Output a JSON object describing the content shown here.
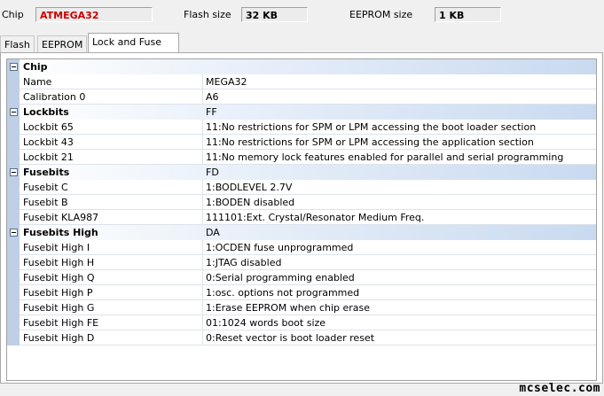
{
  "top": {
    "chip_label": "Chip",
    "chip_value": "ATMEGA32",
    "flash_label": "Flash size",
    "flash_value": "32 KB",
    "eeprom_label": "EEPROM size",
    "eeprom_value": "1 KB"
  },
  "colors": {
    "chip_value": "#cc0000"
  },
  "tabs": [
    {
      "label": "Flash",
      "active": false
    },
    {
      "label": "EEPROM",
      "active": false
    },
    {
      "label": "Lock and Fuse bits",
      "active": true
    }
  ],
  "rows": [
    {
      "type": "cat",
      "name": "Chip",
      "value": ""
    },
    {
      "type": "prop",
      "name": "Name",
      "value": "MEGA32"
    },
    {
      "type": "prop",
      "name": "Calibration 0",
      "value": "A6"
    },
    {
      "type": "cat",
      "name": "Lockbits",
      "value": "FF"
    },
    {
      "type": "prop",
      "name": "Lockbit 65",
      "value": "11:No restrictions for SPM or LPM accessing the boot loader section"
    },
    {
      "type": "prop",
      "name": "Lockbit 43",
      "value": "11:No restrictions for SPM or LPM accessing the application section"
    },
    {
      "type": "prop",
      "name": "Lockbit 21",
      "value": "11:No memory lock features enabled for parallel and serial programming"
    },
    {
      "type": "cat",
      "name": "Fusebits",
      "value": "FD"
    },
    {
      "type": "prop",
      "name": "Fusebit C",
      "value": "1:BODLEVEL 2.7V"
    },
    {
      "type": "prop",
      "name": "Fusebit B",
      "value": "1:BODEN disabled"
    },
    {
      "type": "prop",
      "name": "Fusebit KLA987",
      "value": "111101:Ext. Crystal/Resonator Medium Freq."
    },
    {
      "type": "cat",
      "name": "Fusebits High",
      "value": "DA"
    },
    {
      "type": "prop",
      "name": "Fusebit High I",
      "value": "1:OCDEN fuse unprogrammed"
    },
    {
      "type": "prop",
      "name": "Fusebit High H",
      "value": "1:JTAG disabled"
    },
    {
      "type": "prop",
      "name": "Fusebit High Q",
      "value": "0:Serial programming enabled"
    },
    {
      "type": "prop",
      "name": "Fusebit High P",
      "value": "1:osc. options not programmed"
    },
    {
      "type": "prop",
      "name": "Fusebit High G",
      "value": "1:Erase EEPROM when chip erase"
    },
    {
      "type": "prop",
      "name": "Fusebit High FE",
      "value": "01:1024 words boot size"
    },
    {
      "type": "prop",
      "name": "Fusebit High D",
      "value": "0:Reset vector is boot loader reset"
    }
  ],
  "watermark": "mcselec.com"
}
